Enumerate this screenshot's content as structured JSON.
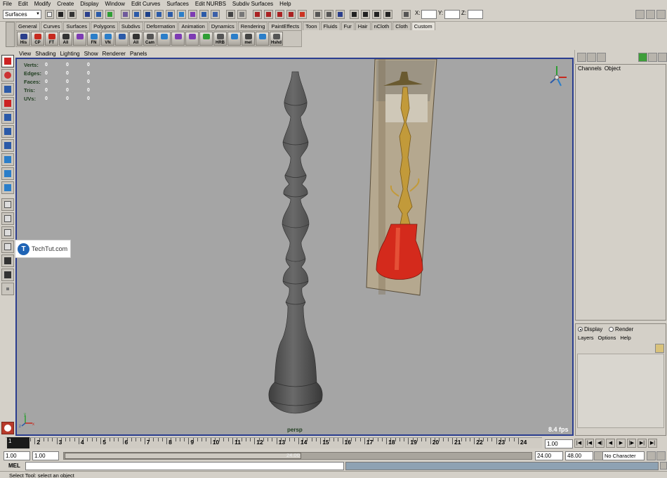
{
  "menubar": [
    "File",
    "Edit",
    "Modify",
    "Create",
    "Display",
    "Window",
    "Edit Curves",
    "Surfaces",
    "Edit NURBS",
    "Subdiv Surfaces",
    "Help"
  ],
  "status_line": {
    "mode": "Surfaces",
    "x_label": "X:",
    "y_label": "Y:",
    "z_label": "Z:"
  },
  "shelf": {
    "tabs": [
      "General",
      "Curves",
      "Surfaces",
      "Polygons",
      "Subdivs",
      "Deformation",
      "Animation",
      "Dynamics",
      "Rendering",
      "PaintEffects",
      "Toon",
      "Fluids",
      "Fur",
      "Hair",
      "nCloth",
      "Cloth",
      "Custom"
    ],
    "active_tab": "Custom",
    "buttons": [
      {
        "label": "His",
        "color": "#2b3f8c"
      },
      {
        "label": "CP",
        "color": "#c62a1f"
      },
      {
        "label": "FT",
        "color": "#c62a1f"
      },
      {
        "label": "All",
        "color": "#333333"
      },
      {
        "label": "",
        "color": "#7d3bb3"
      },
      {
        "label": "FN",
        "color": "#2b7ec9"
      },
      {
        "label": "VN",
        "color": "#2b7ec9"
      },
      {
        "label": "",
        "color": "#2b5aa8"
      },
      {
        "label": "All",
        "color": "#333333"
      },
      {
        "label": "Cam",
        "color": "#555555"
      },
      {
        "label": "",
        "color": "#2b7ec9"
      },
      {
        "label": "",
        "color": "#7d3bb3"
      },
      {
        "label": "",
        "color": "#7d3bb3"
      },
      {
        "label": "",
        "color": "#2e9e34"
      },
      {
        "label": "HRB",
        "color": "#555555"
      },
      {
        "label": "",
        "color": "#2b7ec9"
      },
      {
        "label": "mel",
        "color": "#444444"
      },
      {
        "label": "",
        "color": "#2b7ec9"
      },
      {
        "label": "Hshd",
        "color": "#555555"
      }
    ]
  },
  "panel_menu": [
    "View",
    "Shading",
    "Lighting",
    "Show",
    "Renderer",
    "Panels"
  ],
  "hud": {
    "rows": [
      {
        "label": "Verts:",
        "v1": "0",
        "v2": "0",
        "v3": "0"
      },
      {
        "label": "Edges:",
        "v1": "0",
        "v2": "0",
        "v3": "0"
      },
      {
        "label": "Faces:",
        "v1": "0",
        "v2": "0",
        "v3": "0"
      },
      {
        "label": "Tris:",
        "v1": "0",
        "v2": "0",
        "v3": "0"
      },
      {
        "label": "UVs:",
        "v1": "0",
        "v2": "0",
        "v3": "0"
      }
    ]
  },
  "viewport": {
    "camera": "persp",
    "fps": "8.4 fps",
    "axis_labels": {
      "x": "x",
      "y": "y",
      "z": "z"
    }
  },
  "watermark": {
    "logo_letter": "T",
    "text": "TechTut.com"
  },
  "channel_box": {
    "menu": [
      "Channels",
      "Object"
    ]
  },
  "layer_editor": {
    "display_label": "Display",
    "render_label": "Render",
    "selected": "Display",
    "menu": [
      "Layers",
      "Options",
      "Help"
    ]
  },
  "time_slider": {
    "current_frame": "1",
    "frames": [
      "1",
      "2",
      "3",
      "4",
      "5",
      "6",
      "7",
      "8",
      "9",
      "10",
      "11",
      "12",
      "13",
      "14",
      "15",
      "16",
      "17",
      "18",
      "19",
      "20",
      "21",
      "22",
      "23",
      "24"
    ],
    "current_time": "1.00"
  },
  "range_slider": {
    "start_time": "1.00",
    "playback_start": "1.00",
    "range_label": "24.00",
    "playback_end": "24.00",
    "end_time": "48.00",
    "character_set": "No Character Set"
  },
  "command_line": {
    "label": "MEL"
  },
  "help_line": {
    "text": "Select Tool: select an object"
  }
}
